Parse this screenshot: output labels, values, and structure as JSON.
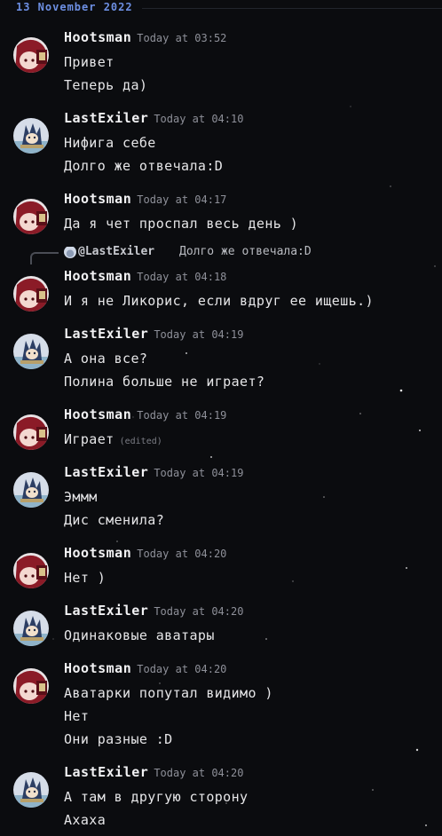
{
  "date_separator": "13 November 2022",
  "colors": {
    "background": "#0b0c0f",
    "date_accent": "#6d8fe3",
    "text": "#e6e6e8",
    "muted": "#8e9099"
  },
  "reply": {
    "user": "@LastExiler",
    "text": "Долго же отвечала:D"
  },
  "messages": [
    {
      "author": "Hootsman",
      "time": "Today at 03:52",
      "avatar": "hootsman-avatar",
      "lines": [
        "Привет",
        "Теперь да)"
      ]
    },
    {
      "author": "LastExiler",
      "time": "Today at 04:10",
      "avatar": "lastexiler-avatar",
      "lines": [
        "Нифига себе",
        "Долго же отвечала:D"
      ]
    },
    {
      "author": "Hootsman",
      "time": "Today at 04:17",
      "avatar": "hootsman-avatar",
      "lines": [
        "Да я чет проспал весь день )"
      ]
    },
    {
      "author": "Hootsman",
      "time": "Today at 04:18",
      "avatar": "hootsman-avatar",
      "lines": [
        "И я не Ликорис, если вдруг ее ищешь.)"
      ]
    },
    {
      "author": "LastExiler",
      "time": "Today at 04:19",
      "avatar": "lastexiler-avatar",
      "lines": [
        "А она все?",
        "Полина больше не играет?"
      ]
    },
    {
      "author": "Hootsman",
      "time": "Today at 04:19",
      "avatar": "hootsman-avatar",
      "lines": [
        "Играет"
      ],
      "edited": "(edited)"
    },
    {
      "author": "LastExiler",
      "time": "Today at 04:19",
      "avatar": "lastexiler-avatar",
      "lines": [
        "Эммм",
        "Дис сменила?"
      ]
    },
    {
      "author": "Hootsman",
      "time": "Today at 04:20",
      "avatar": "hootsman-avatar",
      "lines": [
        "Нет )"
      ]
    },
    {
      "author": "LastExiler",
      "time": "Today at 04:20",
      "avatar": "lastexiler-avatar",
      "lines": [
        "Одинаковые аватары"
      ]
    },
    {
      "author": "Hootsman",
      "time": "Today at 04:20",
      "avatar": "hootsman-avatar",
      "lines": [
        "Аватарки попутал видимо )",
        "Нет",
        "Они разные :D"
      ]
    },
    {
      "author": "LastExiler",
      "time": "Today at 04:20",
      "avatar": "lastexiler-avatar",
      "lines": [
        "А там в другую сторону",
        "Ахаха"
      ]
    }
  ]
}
